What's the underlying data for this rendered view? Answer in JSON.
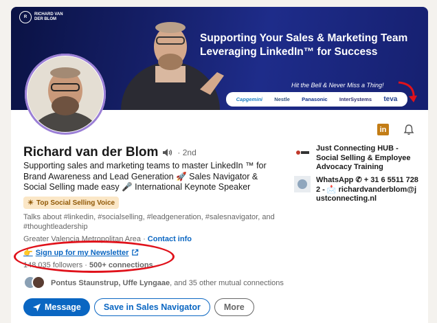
{
  "banner": {
    "logo_line1": "RICHARD VAN",
    "logo_line2": "DER BLOM",
    "headline_line1": "Supporting Your Sales & Marketing Team",
    "headline_line2": "Leveraging LinkedIn™ for Success",
    "tagline": "Hit the Bell & Never Miss a Thing!",
    "client_logos": [
      "Capgemini",
      "Nestle",
      "Panasonic",
      "InterSystems",
      "teva"
    ]
  },
  "profile": {
    "name": "Richard van der Blom",
    "degree": "· 2nd",
    "headline": "Supporting sales and marketing teams to master LinkedIn ™ for Brand Awareness and Lead Generation 🚀 Sales Navigator & Social Selling made easy 🎤 International Keynote Speaker",
    "badge": "Top Social Selling Voice",
    "talks_about": "Talks about #linkedin, #socialselling, #leadgeneration, #salesnavigator, and #thoughtleadership",
    "location": "Greater Valencia Metropolitan Area",
    "separator": "·",
    "contact_info": "Contact info",
    "newsletter": "Sign up for my Newsletter",
    "followers_count": "148,035 followers",
    "followers_sep": "·",
    "connections": "500+ connections",
    "mutual_names": "Pontus Staunstrup, Uffe Lyngaae",
    "mutual_rest": ", and 35 other mutual connections"
  },
  "actions": {
    "message": "Message",
    "save_sales_nav": "Save in Sales Navigator",
    "more": "More"
  },
  "side": {
    "company": "Just Connecting HUB - Social Selling & Employee Advocacy Training",
    "contact": "WhatsApp ✆ + 31 6 5511 7282 - 📩 richardvanderblom@justconnecting.nl"
  },
  "colors": {
    "linkedin_blue": "#0a66c2",
    "badge_bg": "#fbe7c7",
    "circle_red": "#e0121b",
    "linkedin_orange": "#c37d16"
  },
  "icons": [
    "speaker-icon",
    "linkedin-icon",
    "bell-icon",
    "external-link-icon",
    "send-icon",
    "sun-badge-icon",
    "pointing-hand-icon"
  ]
}
